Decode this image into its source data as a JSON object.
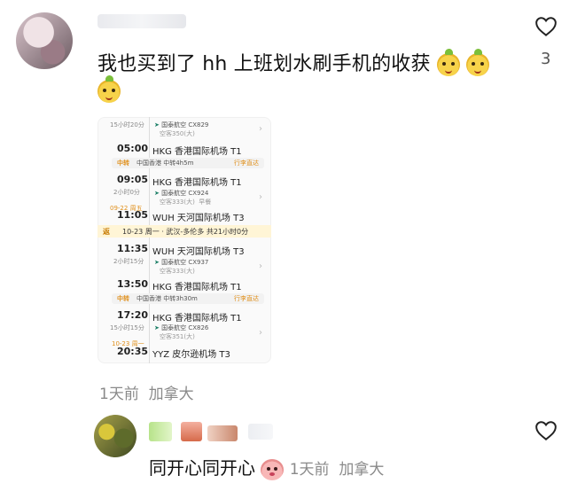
{
  "comment1": {
    "text": "我也买到了 hh 上班划水刷手机的收获",
    "like_count": "3",
    "time": "1天前",
    "location": "加拿大"
  },
  "itinerary": {
    "segments_top": {
      "duration": "15小时20分",
      "airline": "国泰航空 CX829",
      "aircraft": "空客350(大)"
    },
    "dep1": {
      "time": "05:00",
      "airport": "HKG 香港国际机场 T1"
    },
    "transfer1": {
      "tag": "中转",
      "text": "中国香港 中转4h5m",
      "action": "行李直达"
    },
    "dep2": {
      "time": "09:05",
      "airport": "HKG 香港国际机场 T1",
      "duration": "2小时0分",
      "airline": "国泰航空 CX924",
      "aircraft": "空客333(大)",
      "meal": "早餐"
    },
    "arr2": {
      "date": "09-22 周五",
      "time": "11:05",
      "airport": "WUH 天河国际机场 T3"
    },
    "return": {
      "tag": "返",
      "text": "10-23 周一 · 武汉-多伦多 共21小时0分"
    },
    "dep3": {
      "time": "11:35",
      "airport": "WUH 天河国际机场 T3",
      "duration": "2小时15分",
      "airline": "国泰航空 CX937",
      "aircraft": "空客333(大)"
    },
    "arr3": {
      "time": "13:50",
      "airport": "HKG 香港国际机场 T1"
    },
    "transfer2": {
      "tag": "中转",
      "text": "中国香港 中转3h30m",
      "action": "行李直达"
    },
    "dep4": {
      "time": "17:20",
      "airport": "HKG 香港国际机场 T1",
      "duration": "15小时15分",
      "airline": "国泰航空 CX826",
      "aircraft": "空客351(大)"
    },
    "arr4": {
      "date": "10-23 周一",
      "time": "20:35",
      "airport": "YYZ 皮尔逊机场 T3"
    }
  },
  "comment2": {
    "text": "同开心同开心",
    "time": "1天前",
    "location": "加拿大"
  },
  "icons": {
    "like": "heart-outline-icon",
    "sticker": "yellow-cartoon-sticker",
    "plane": "airline-logo-icon"
  }
}
